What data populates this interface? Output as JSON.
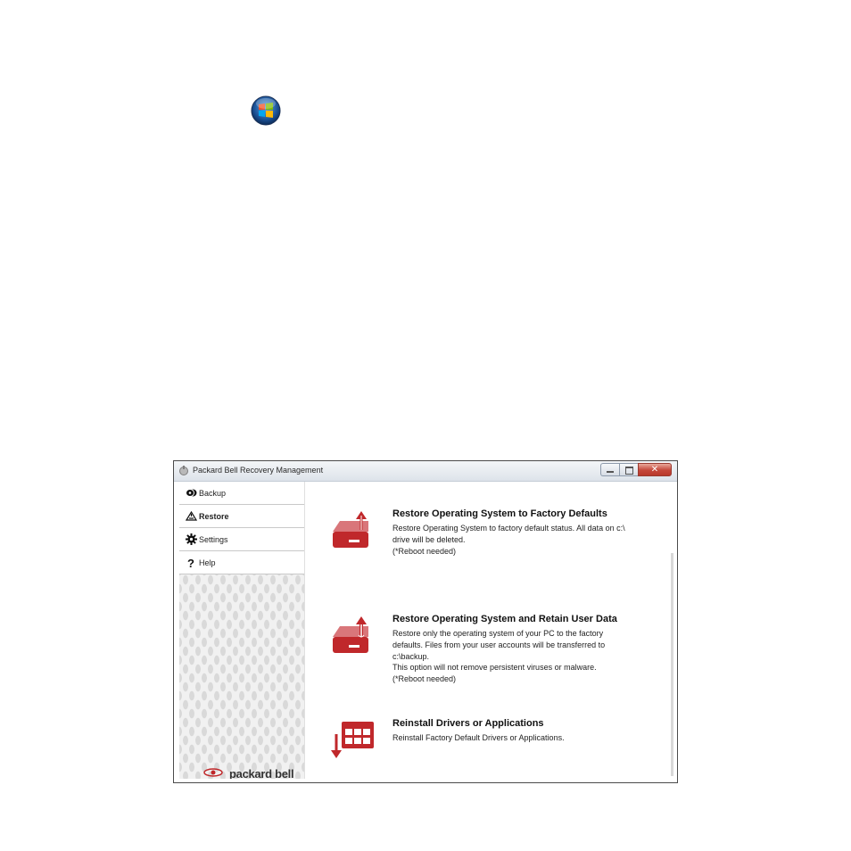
{
  "window": {
    "title": "Packard Bell Recovery Management",
    "close_glyph": "✕"
  },
  "sidebar": {
    "items": [
      {
        "label": "Backup",
        "icon": "backup-icon"
      },
      {
        "label": "Restore",
        "icon": "restore-icon",
        "active": true
      },
      {
        "label": "Settings",
        "icon": "gear-icon"
      },
      {
        "label": "Help",
        "icon": "help-icon"
      }
    ],
    "brand": "packard bell"
  },
  "options": [
    {
      "title": "Restore Operating System to Factory Defaults",
      "desc": [
        "Restore Operating System to factory default status. All data on c:\\",
        "drive will be deleted.",
        "(*Reboot needed)"
      ],
      "icon": "restore-drive-icon"
    },
    {
      "title": "Restore Operating System and Retain User Data",
      "desc": [
        "Restore only the operating system of your PC to the factory",
        "defaults. Files from your user accounts will be transferred to",
        "c:\\backup.",
        "This option will not remove persistent viruses or malware.",
        "(*Reboot needed)"
      ],
      "icon": "retain-data-drive-icon"
    },
    {
      "title": "Reinstall Drivers or Applications",
      "desc": [
        "Reinstall Factory Default Drivers or Applications."
      ],
      "icon": "reinstall-apps-icon"
    }
  ],
  "colors": {
    "accent_red": "#c0282b",
    "close_red": "#c5473a"
  }
}
